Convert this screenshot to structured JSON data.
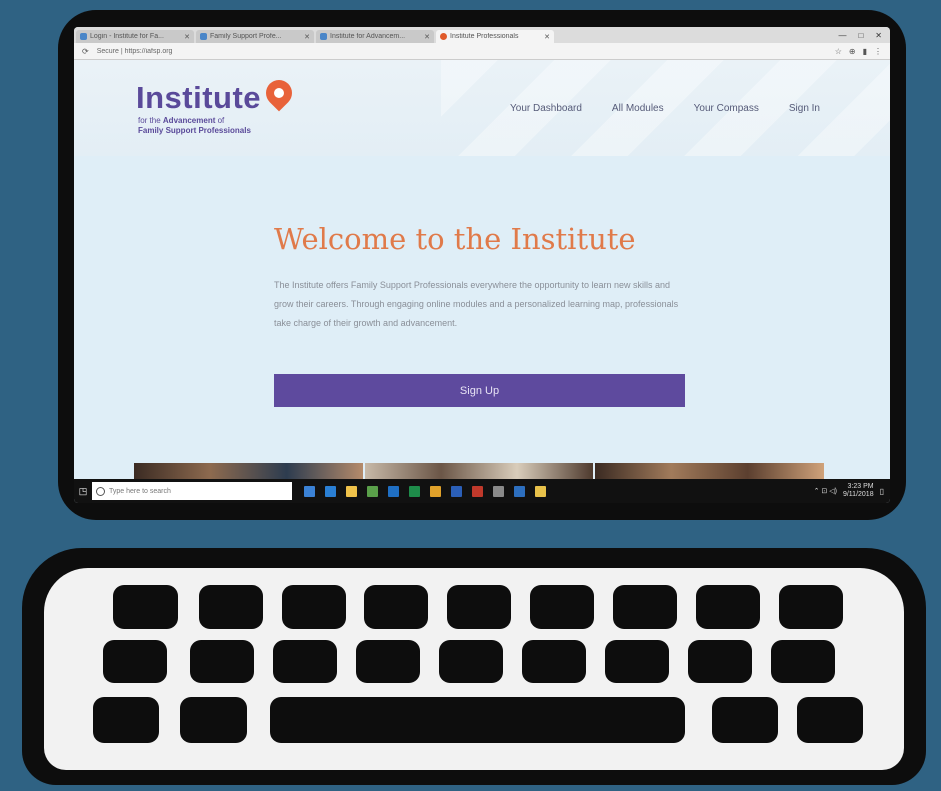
{
  "browser": {
    "tabs": [
      {
        "label": "Login - Institute for Fa...",
        "active": false
      },
      {
        "label": "Family Support Profe...",
        "active": false
      },
      {
        "label": "Institute for Advancem...",
        "active": false
      },
      {
        "label": "Institute Professionals",
        "active": true
      }
    ],
    "window_controls": [
      "—",
      "□",
      "✕"
    ],
    "nav_label": "⟳",
    "url": "Secure | https://iafsp.org",
    "toolbar_icons": [
      "☆",
      "⊕",
      "▮",
      "⋮"
    ]
  },
  "site": {
    "logo_text": "Institute",
    "logo_sub1_prefix": "for the ",
    "logo_sub1_bold": "Advancement",
    "logo_sub1_suffix": " of",
    "logo_sub2": "Family Support Professionals",
    "nav": [
      "Your Dashboard",
      "All Modules",
      "Your Compass",
      "Sign In"
    ]
  },
  "hero": {
    "title": "Welcome to the Institute",
    "body": "The Institute offers Family Support Professionals everywhere the opportunity to learn new skills and grow their careers. Through engaging online modules and a personalized learning map, professionals take charge of their growth and advancement.",
    "button": "Sign Up"
  },
  "taskbar": {
    "start": "◳",
    "search_placeholder": "Type here to search",
    "tray": "⌃ ⊡ ◁)",
    "time": "3:23 PM",
    "date": "9/11/2018"
  },
  "colors": {
    "accent_purple": "#5e4a9e",
    "title_orange": "#e07a4a",
    "background": "#2f6283"
  }
}
